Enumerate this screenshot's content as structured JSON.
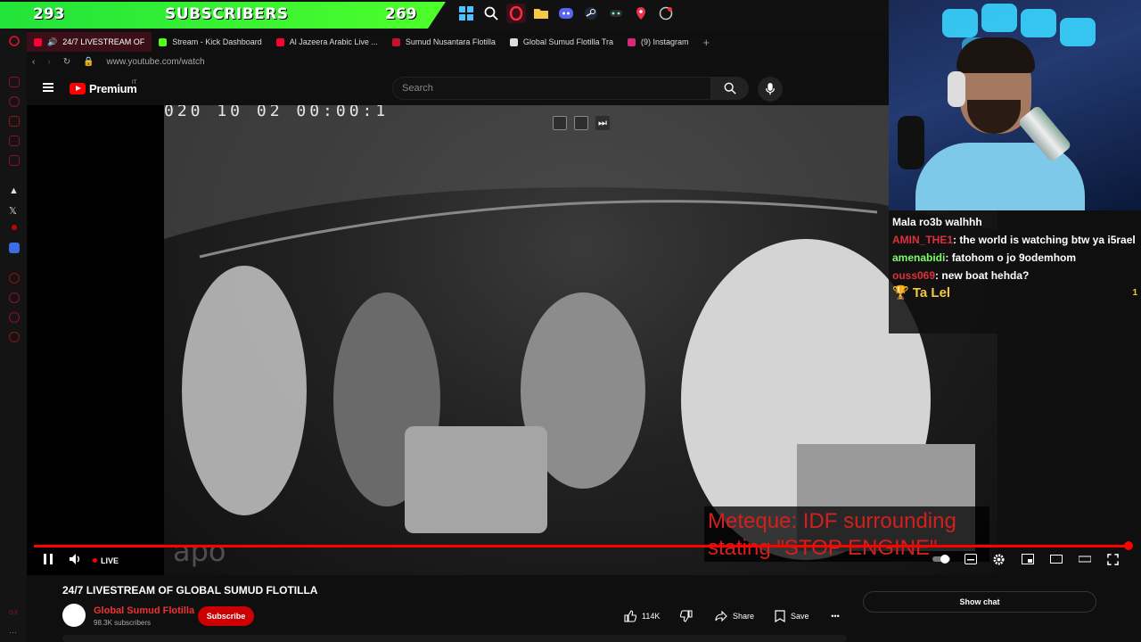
{
  "overlay": {
    "subscriber_left": "293",
    "subscriber_label": "SUBSCRIBERS",
    "subscriber_right": "269"
  },
  "tabs": [
    {
      "label": "24/7 LIVESTREAM OF",
      "color": "#ff0033",
      "active": true
    },
    {
      "label": "Stream - Kick Dashboard",
      "color": "#53fc18"
    },
    {
      "label": "Al Jazeera Arabic Live ...",
      "color": "#ff0033"
    },
    {
      "label": "Sumud Nusantara Flotilla",
      "color": "#c8102e"
    },
    {
      "label": "Global Sumud Flotilla Tra",
      "color": "#ffffff"
    },
    {
      "label": "(9) Instagram",
      "color": "#d62976"
    }
  ],
  "address": {
    "url": "www.youtube.com/watch"
  },
  "youtube": {
    "brand": "Premium",
    "country": "IT",
    "search_placeholder": "Search"
  },
  "video": {
    "timestamp_overlay": "020 10 02 00:00:1",
    "watermark": "apo",
    "caption_line1": "Meteque: IDF surrounding",
    "caption_line2": "stating \"STOP ENGINE\"",
    "live_label": "LIVE",
    "progress_percent": 100
  },
  "meta": {
    "title": "24/7 LIVESTREAM OF GLOBAL SUMUD FLOTILLA",
    "channel": "Global Sumud Flotilla",
    "subscribers": "98.3K subscribers",
    "subscribe_label": "Subscribe",
    "likes": "114K",
    "share_label": "Share",
    "save_label": "Save",
    "show_chat_label": "Show chat"
  },
  "chat": {
    "messages": [
      {
        "user": "",
        "user_color": "#ffffff",
        "text": "Mala ro3b walhhh"
      },
      {
        "user": "AMIN_THE1",
        "user_color": "#e0303a",
        "text": ": the world is watching btw ya i5rael"
      },
      {
        "user": "amenabidi",
        "user_color": "#7cfc6a",
        "text": ": fatohom o jo 9odemhom"
      },
      {
        "user": "ouss069",
        "user_color": "#e0303a",
        "text": ": new boat hehda?"
      }
    ],
    "highlight_name": "Ta Lel",
    "highlight_count": "1"
  }
}
